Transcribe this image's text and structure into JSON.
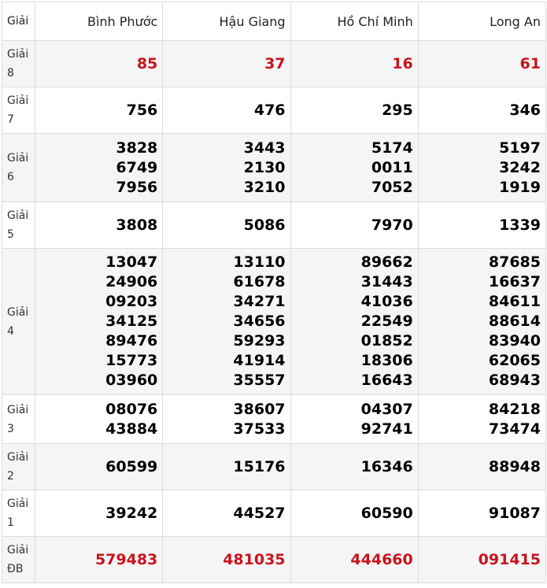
{
  "header": {
    "label": "Giải",
    "provinces": [
      "Bình Phước",
      "Hậu Giang",
      "Hồ Chí Minh",
      "Long An"
    ]
  },
  "colors": {
    "special_number": "#c8141e",
    "shaded_row": "#f5f5f5",
    "border": "#dcdcdc"
  },
  "rows": [
    {
      "label": [
        "Giải",
        "8"
      ],
      "cells": [
        [
          "85"
        ],
        [
          "37"
        ],
        [
          "16"
        ],
        [
          "61"
        ]
      ]
    },
    {
      "label": [
        "Giải",
        "7"
      ],
      "cells": [
        [
          "756"
        ],
        [
          "476"
        ],
        [
          "295"
        ],
        [
          "346"
        ]
      ]
    },
    {
      "label": [
        "Giải",
        "6"
      ],
      "cells": [
        [
          "3828",
          "6749",
          "7956"
        ],
        [
          "3443",
          "2130",
          "3210"
        ],
        [
          "5174",
          "0011",
          "7052"
        ],
        [
          "5197",
          "3242",
          "1919"
        ]
      ]
    },
    {
      "label": [
        "Giải",
        "5"
      ],
      "cells": [
        [
          "3808"
        ],
        [
          "5086"
        ],
        [
          "7970"
        ],
        [
          "1339"
        ]
      ]
    },
    {
      "label": [
        "Giải",
        "4"
      ],
      "cells": [
        [
          "13047",
          "24906",
          "09203",
          "34125",
          "89476",
          "15773",
          "03960"
        ],
        [
          "13110",
          "61678",
          "34271",
          "34656",
          "59293",
          "41914",
          "35557"
        ],
        [
          "89662",
          "31443",
          "41036",
          "22549",
          "01852",
          "18306",
          "16643"
        ],
        [
          "87685",
          "16637",
          "84611",
          "88614",
          "83940",
          "62065",
          "68943"
        ]
      ]
    },
    {
      "label": [
        "Giải",
        "3"
      ],
      "cells": [
        [
          "08076",
          "43884"
        ],
        [
          "38607",
          "37533"
        ],
        [
          "04307",
          "92741"
        ],
        [
          "84218",
          "73474"
        ]
      ]
    },
    {
      "label": [
        "Giải",
        "2"
      ],
      "cells": [
        [
          "60599"
        ],
        [
          "15176"
        ],
        [
          "16346"
        ],
        [
          "88948"
        ]
      ]
    },
    {
      "label": [
        "Giải",
        "1"
      ],
      "cells": [
        [
          "39242"
        ],
        [
          "44527"
        ],
        [
          "60590"
        ],
        [
          "91087"
        ]
      ]
    },
    {
      "label": [
        "Giải",
        "ĐB"
      ],
      "cells": [
        [
          "579483"
        ],
        [
          "481035"
        ],
        [
          "444660"
        ],
        [
          "091415"
        ]
      ]
    }
  ]
}
